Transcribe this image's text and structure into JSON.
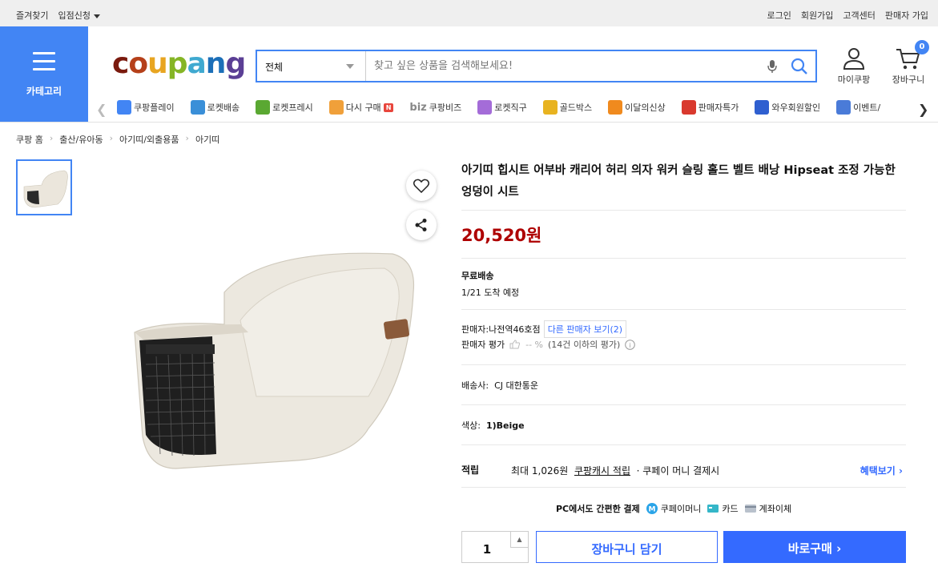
{
  "topbar": {
    "bookmark": "즐겨찾기",
    "partner": "입점신청",
    "login": "로그인",
    "signup": "회원가입",
    "support": "고객센터",
    "seller_signup": "판매자 가입"
  },
  "category_label": "카테고리",
  "logo": {
    "text": "coupang",
    "colors": [
      "#7a1a0e",
      "#b5401a",
      "#e8a521",
      "#85b526",
      "#3fa9d0",
      "#1c6fb8",
      "#5b3f95"
    ]
  },
  "search": {
    "category": "전체",
    "placeholder": "찾고 싶은 상품을 검색해보세요!"
  },
  "header": {
    "mycoupang": "마이쿠팡",
    "cart": "장바구니",
    "cart_count": "0"
  },
  "nav": [
    {
      "label": "쿠팡플레이",
      "color": "#4285f4"
    },
    {
      "label": "로켓배송",
      "color": "#3a8fd8"
    },
    {
      "label": "로켓프레시",
      "color": "#5aa832"
    },
    {
      "label": "다시 구매",
      "color": "#f0a03a",
      "badge": "N"
    },
    {
      "label": "쿠팡비즈",
      "color": "#346aff",
      "prefix": "biz"
    },
    {
      "label": "로켓직구",
      "color": "#a46cd8"
    },
    {
      "label": "골드박스",
      "color": "#e8b320"
    },
    {
      "label": "이달의신상",
      "color": "#f08a1e"
    },
    {
      "label": "판매자특가",
      "color": "#d9392e"
    },
    {
      "label": "와우회원할인",
      "color": "#2f5fd0"
    },
    {
      "label": "이벤트/",
      "color": "#4a7bd8"
    }
  ],
  "breadcrumb": [
    "쿠팡 홈",
    "출산/유아동",
    "아기띠/외출용품",
    "아기띠"
  ],
  "product": {
    "title": "아기띠 힙시트 어부바 캐리어 허리 의자 워커 슬링 홀드 벨트 배낭 Hipseat 조정 가능한 엉덩이 시트",
    "price": "20,520원",
    "shipping_type": "무료배송",
    "arrival": "1/21 도착 예정",
    "seller_label": "판매자:",
    "seller": "나전역46호점",
    "other_sellers": "다른 판매자 보기(2)",
    "seller_rating_label": "판매자 평가",
    "seller_rating_value": "-- %",
    "seller_rating_note": "(14건 이하의 평가)",
    "carrier_label": "배송사:",
    "carrier": "CJ 대한통운",
    "color_label": "색상:",
    "color": "1)Beige"
  },
  "reward": {
    "label": "적립",
    "text_prefix": "최대 1,026원",
    "cash_link": "쿠팡캐시 적립",
    "text_suffix": "· 쿠페이 머니 결제시",
    "more": "혜택보기"
  },
  "pc_pay": {
    "label": "PC에서도 간편한 결제",
    "money": "쿠페이머니",
    "card": "카드",
    "bank": "계좌이체"
  },
  "actions": {
    "quantity": "1",
    "cart": "장바구니 담기",
    "buy": "바로구매"
  }
}
